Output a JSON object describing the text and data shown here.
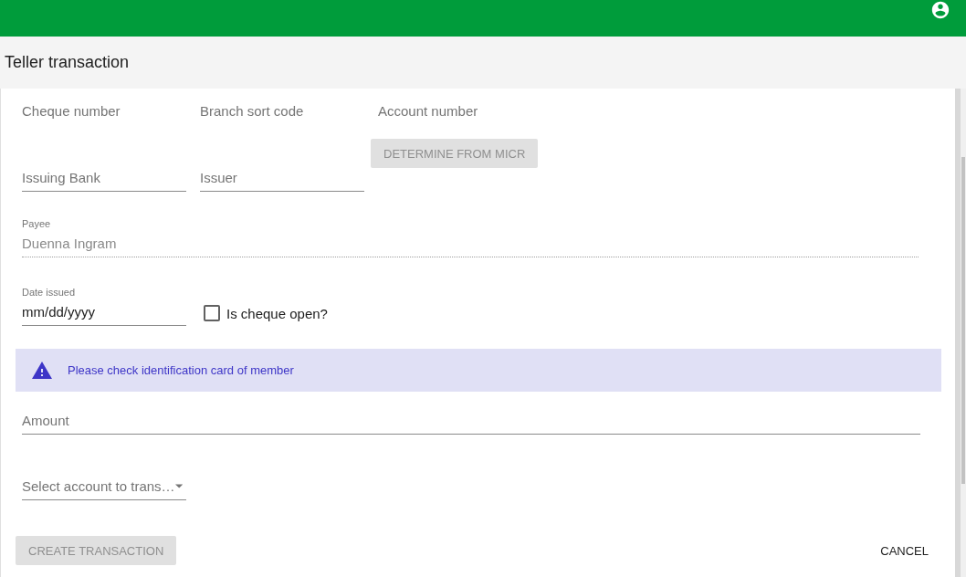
{
  "page_title": "Teller transaction",
  "micr_fields": [
    {
      "placeholder": "Cheque number"
    },
    {
      "placeholder": "Branch sort code"
    },
    {
      "placeholder": "Account number"
    }
  ],
  "bank_fields": [
    {
      "placeholder": "Issuing Bank"
    },
    {
      "placeholder": "Issuer"
    }
  ],
  "determine_button": {
    "label": "DETERMINE FROM MICR",
    "disabled": true
  },
  "payee": {
    "label": "Payee",
    "value": "Duenna Ingram",
    "disabled": true
  },
  "date_issued": {
    "label": "Date issued",
    "value": "mm/dd/yyyy"
  },
  "cheque_open": {
    "label": "Is cheque open?",
    "checked": false
  },
  "alert": {
    "kind": "warning",
    "message": "Please check identification card of member"
  },
  "amount": {
    "placeholder": "Amount"
  },
  "account_select": {
    "placeholder": "Select account to trans…"
  },
  "actions": [
    {
      "label": "CREATE TRANSACTION",
      "kind": "raised",
      "disabled": true
    },
    {
      "label": "CANCEL",
      "kind": "text",
      "disabled": false
    }
  ]
}
